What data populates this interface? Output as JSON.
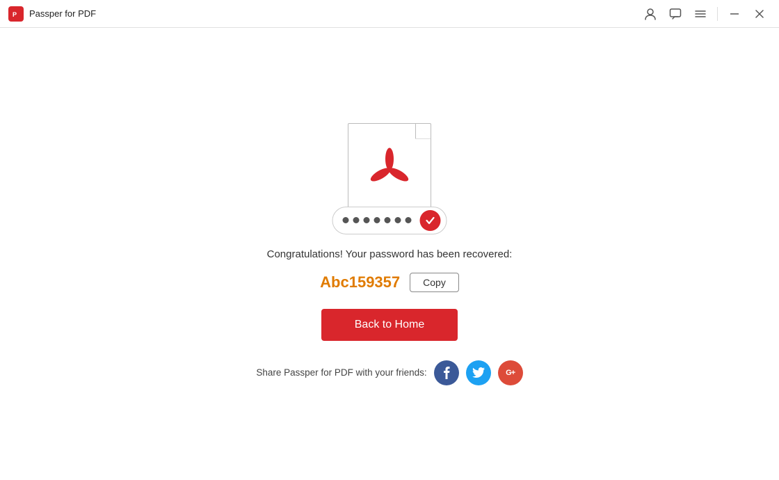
{
  "titlebar": {
    "app_name": "Passper for PDF",
    "logo_alt": "Passper logo"
  },
  "main": {
    "congrats_text": "Congratulations! Your password has been recovered:",
    "password": "Abc159357",
    "copy_label": "Copy",
    "back_to_home_label": "Back to Home",
    "share_text": "Share Passper for PDF with your friends:",
    "dots_count": 7
  },
  "social": {
    "facebook_label": "f",
    "twitter_label": "t",
    "google_label": "G+"
  },
  "icons": {
    "user_icon": "👤",
    "chat_icon": "💬",
    "menu_icon": "☰",
    "minimize_icon": "—",
    "close_icon": "✕"
  }
}
